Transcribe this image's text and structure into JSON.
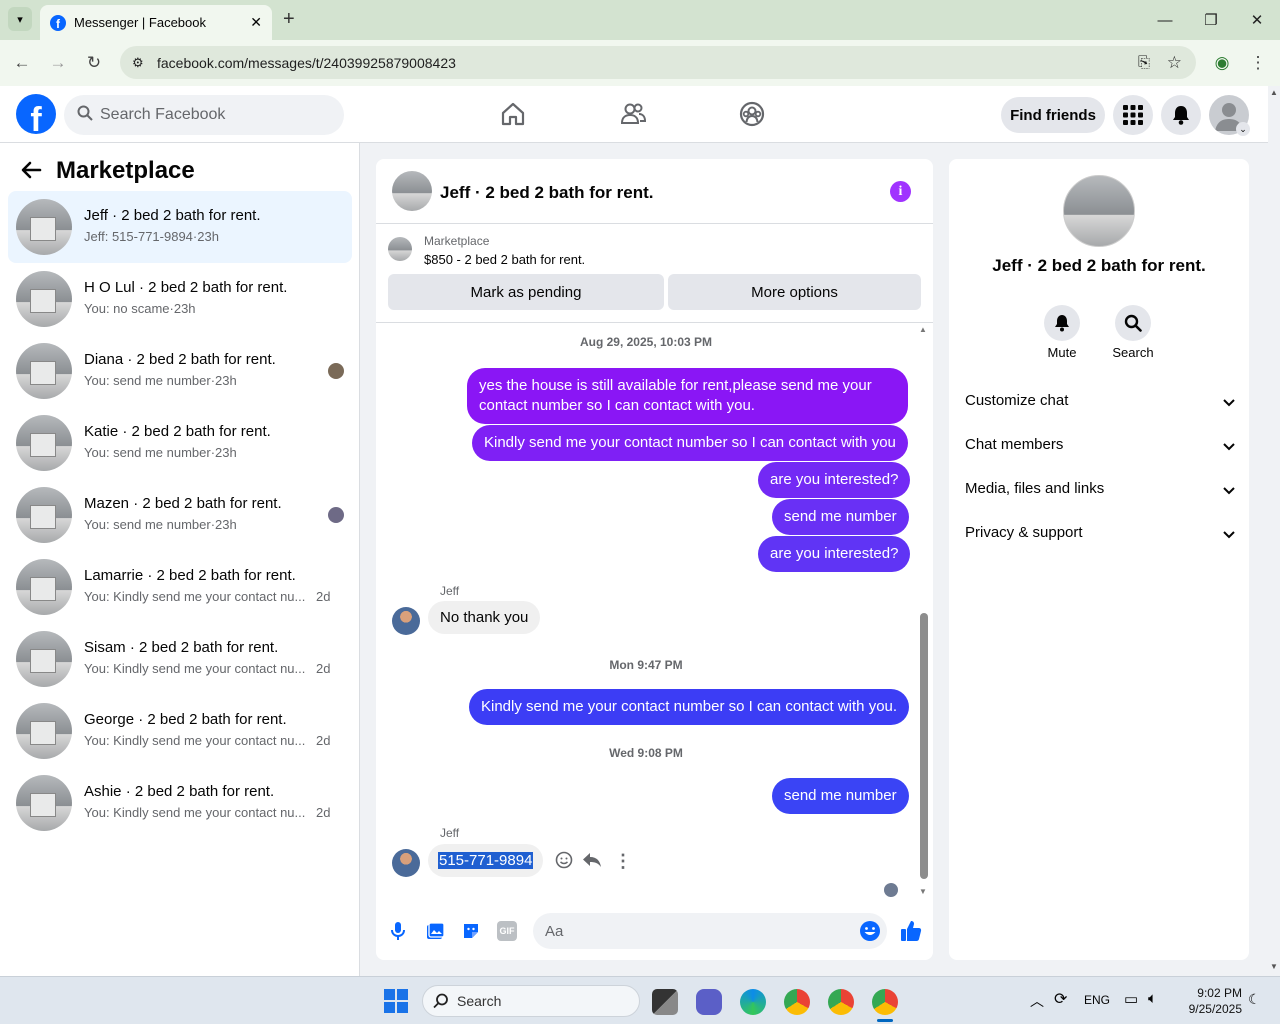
{
  "browser": {
    "tab_title": "Messenger | Facebook",
    "url": "facebook.com/messages/t/24039925879008423"
  },
  "header": {
    "search_placeholder": "Search Facebook",
    "find_friends": "Find friends"
  },
  "left": {
    "title": "Marketplace",
    "conversations": [
      {
        "title": "Jeff · 2 bed 2 bath for rent.",
        "preview": "Jeff: 515-771-9894·23h",
        "time": ""
      },
      {
        "title": "H O Lul · 2 bed 2 bath for rent.",
        "preview": "You: no scame·23h",
        "time": ""
      },
      {
        "title": "Diana · 2 bed 2 bath for rent.",
        "preview": "You: send me number·23h",
        "time": ""
      },
      {
        "title": "Katie · 2 bed 2 bath for rent.",
        "preview": "You: send me number·23h",
        "time": ""
      },
      {
        "title": "Mazen · 2 bed 2 bath for rent.",
        "preview": "You: send me number·23h",
        "time": ""
      },
      {
        "title": "Lamarrie · 2 bed 2 bath for rent.",
        "preview": "You: Kindly send me your contact nu...",
        "time": "2d"
      },
      {
        "title": "Sisam · 2 bed 2 bath for rent.",
        "preview": "You: Kindly send me your contact nu...",
        "time": "2d"
      },
      {
        "title": "George · 2 bed 2 bath for rent.",
        "preview": "You: Kindly send me your contact nu...",
        "time": "2d"
      },
      {
        "title": "Ashie · 2 bed 2 bath for rent.",
        "preview": "You: Kindly send me your contact nu...",
        "time": "2d"
      }
    ]
  },
  "chat": {
    "title": "Jeff · 2 bed 2 bath for rent.",
    "marketplace_label": "Marketplace",
    "listing": "$850 - 2 bed 2 bath for rent.",
    "mark_pending": "Mark as pending",
    "more_options": "More options",
    "ts1": "Aug 29, 2025, 10:03 PM",
    "m1": "yes the house is still available for rent,please send me your contact number so I can contact with you.",
    "m2": "Kindly send me your contact number so I can contact with you",
    "m3": "are you interested?",
    "m4": "send me number",
    "m5": "are you interested?",
    "sender1": "Jeff",
    "in1": "No thank you",
    "ts2": "Mon 9:47 PM",
    "m6": "Kindly send me your contact number so I can contact with you.",
    "ts3": "Wed 9:08 PM",
    "m7": "send me number",
    "sender2": "Jeff",
    "in2": "515-771-9894",
    "composer_placeholder": "Aa"
  },
  "right": {
    "name": "Jeff · 2 bed 2 bath for rent.",
    "mute": "Mute",
    "search": "Search",
    "sections": [
      "Customize chat",
      "Chat members",
      "Media, files and links",
      "Privacy & support"
    ]
  },
  "taskbar": {
    "search": "Search",
    "lang": "ENG",
    "time": "9:02 PM",
    "date": "9/25/2025"
  },
  "colors": {
    "fb_blue": "#0866ff",
    "bubble_purple": "#8a16f5",
    "bubble_blue": "#3c3df5",
    "selected_bg": "#ebf5ff"
  }
}
